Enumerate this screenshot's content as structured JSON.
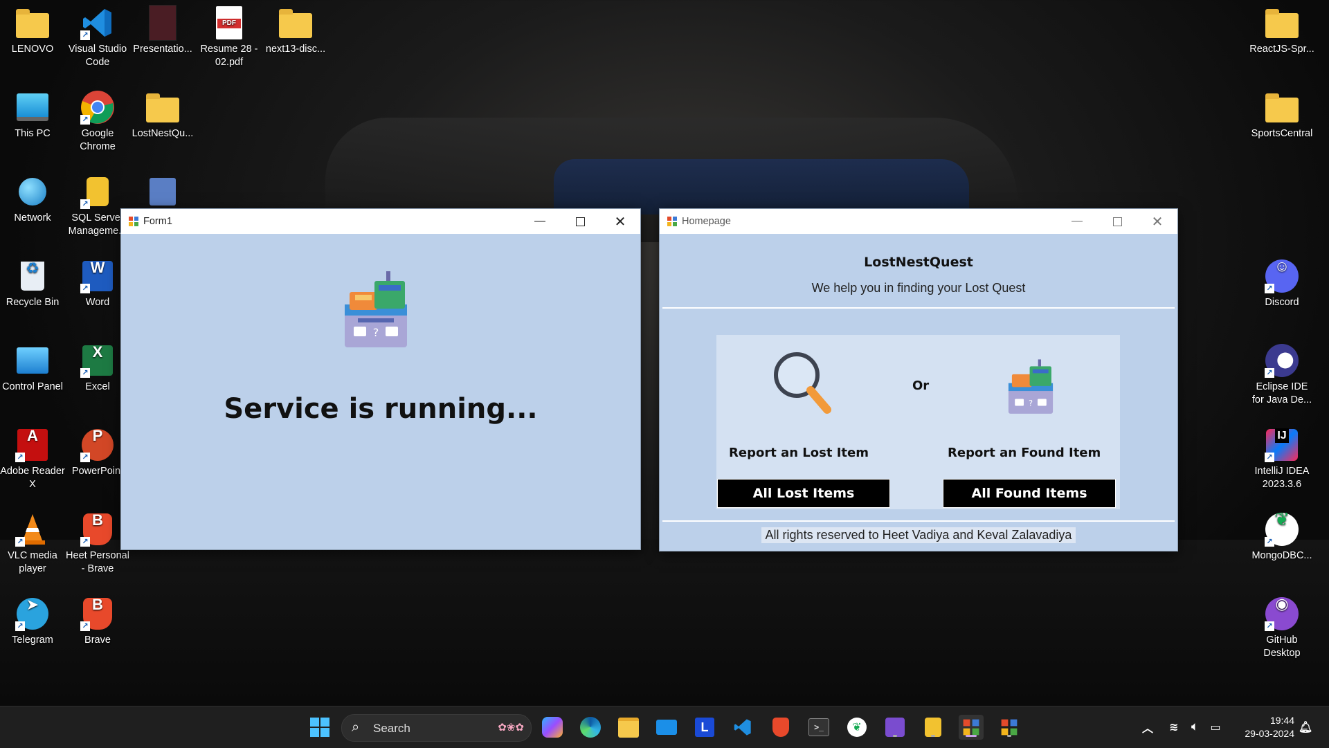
{
  "desktop": {
    "left_icons": [
      {
        "label": "LENOVO"
      },
      {
        "label": "Visual Studio Code"
      },
      {
        "label": "Presentatio..."
      },
      {
        "label": "Resume 28 - 02.pdf"
      },
      {
        "label": "next13-disc..."
      },
      {
        "label": "This PC"
      },
      {
        "label": "Google Chrome"
      },
      {
        "label": "LostNestQu..."
      },
      {
        "label": "Network"
      },
      {
        "label": "SQL Server Manageme..."
      },
      {
        "label": "Recycle Bin"
      },
      {
        "label": "Word"
      },
      {
        "label": "Control Panel"
      },
      {
        "label": "Excel"
      },
      {
        "label": "Adobe Reader X"
      },
      {
        "label": "PowerPoint"
      },
      {
        "label": "VLC media player"
      },
      {
        "label": "Heet Personal - Brave"
      },
      {
        "label": "Telegram"
      },
      {
        "label": "Brave"
      }
    ],
    "right_icons": [
      {
        "label": "ReactJS-Spr..."
      },
      {
        "label": "SportsCentral"
      },
      {
        "label": "Discord"
      },
      {
        "label": "Eclipse IDE for Java De..."
      },
      {
        "label": "IntelliJ IDEA 2023.3.6"
      },
      {
        "label": "MongoDBC..."
      },
      {
        "label": "GitHub Desktop"
      }
    ]
  },
  "form1": {
    "title": "Form1",
    "message": "Service is running..."
  },
  "homepage": {
    "title": "Homepage",
    "app_title": "LostNestQuest",
    "tagline": "We help you in finding your Lost Quest",
    "or_label": "Or",
    "report_lost_label": "Report an Lost Item",
    "report_found_label": "Report an Found Item",
    "all_lost_button": "All Lost Items",
    "all_found_button": "All Found Items",
    "footer": "All rights reserved to Heet Vadiya and Keval Zalavadiya"
  },
  "taskbar": {
    "search_label": "Search",
    "time": "19:44",
    "date": "29-03-2024"
  },
  "colors": {
    "form_bg": "#bcd0ea",
    "panel_bg": "#d4e1f2",
    "button_bg": "#000000",
    "taskbar_bg": "#1f1f1f"
  }
}
